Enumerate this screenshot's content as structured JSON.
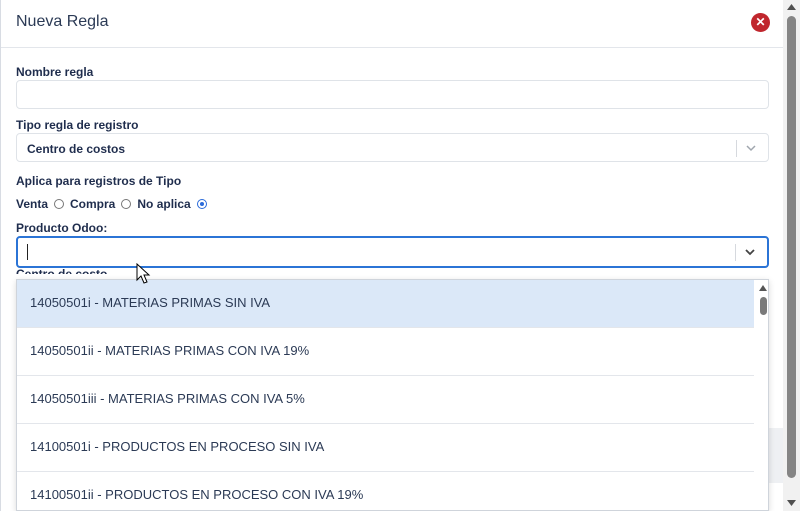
{
  "modal": {
    "title": "Nueva Regla"
  },
  "form": {
    "nombre_regla": {
      "label": "Nombre regla",
      "value": ""
    },
    "tipo_regla": {
      "label": "Tipo regla de registro",
      "selected": "Centro de costos"
    },
    "aplica": {
      "label": "Aplica para registros de Tipo",
      "options": [
        {
          "label": "Venta",
          "checked": false
        },
        {
          "label": "Compra",
          "checked": false
        },
        {
          "label": "No aplica",
          "checked": true
        }
      ]
    },
    "producto_odoo": {
      "label": "Producto Odoo:",
      "value": ""
    },
    "centro_costo": {
      "label": "Centro de costo"
    }
  },
  "dropdown": {
    "items": [
      "14050501i - MATERIAS PRIMAS SIN IVA",
      "14050501ii - MATERIAS PRIMAS CON IVA 19%",
      "14050501iii - MATERIAS PRIMAS CON IVA 5%",
      "14100501i - PRODUCTOS EN PROCESO SIN IVA",
      "14100501ii - PRODUCTOS EN PROCESO CON IVA 19%"
    ]
  },
  "icons": {
    "close": "close-icon",
    "chevron": "chevron-down-icon",
    "cursor": "mouse-pointer-icon"
  },
  "colors": {
    "accent": "#2b74d6",
    "close": "#c0262d",
    "highlight": "#dbe8f8"
  }
}
